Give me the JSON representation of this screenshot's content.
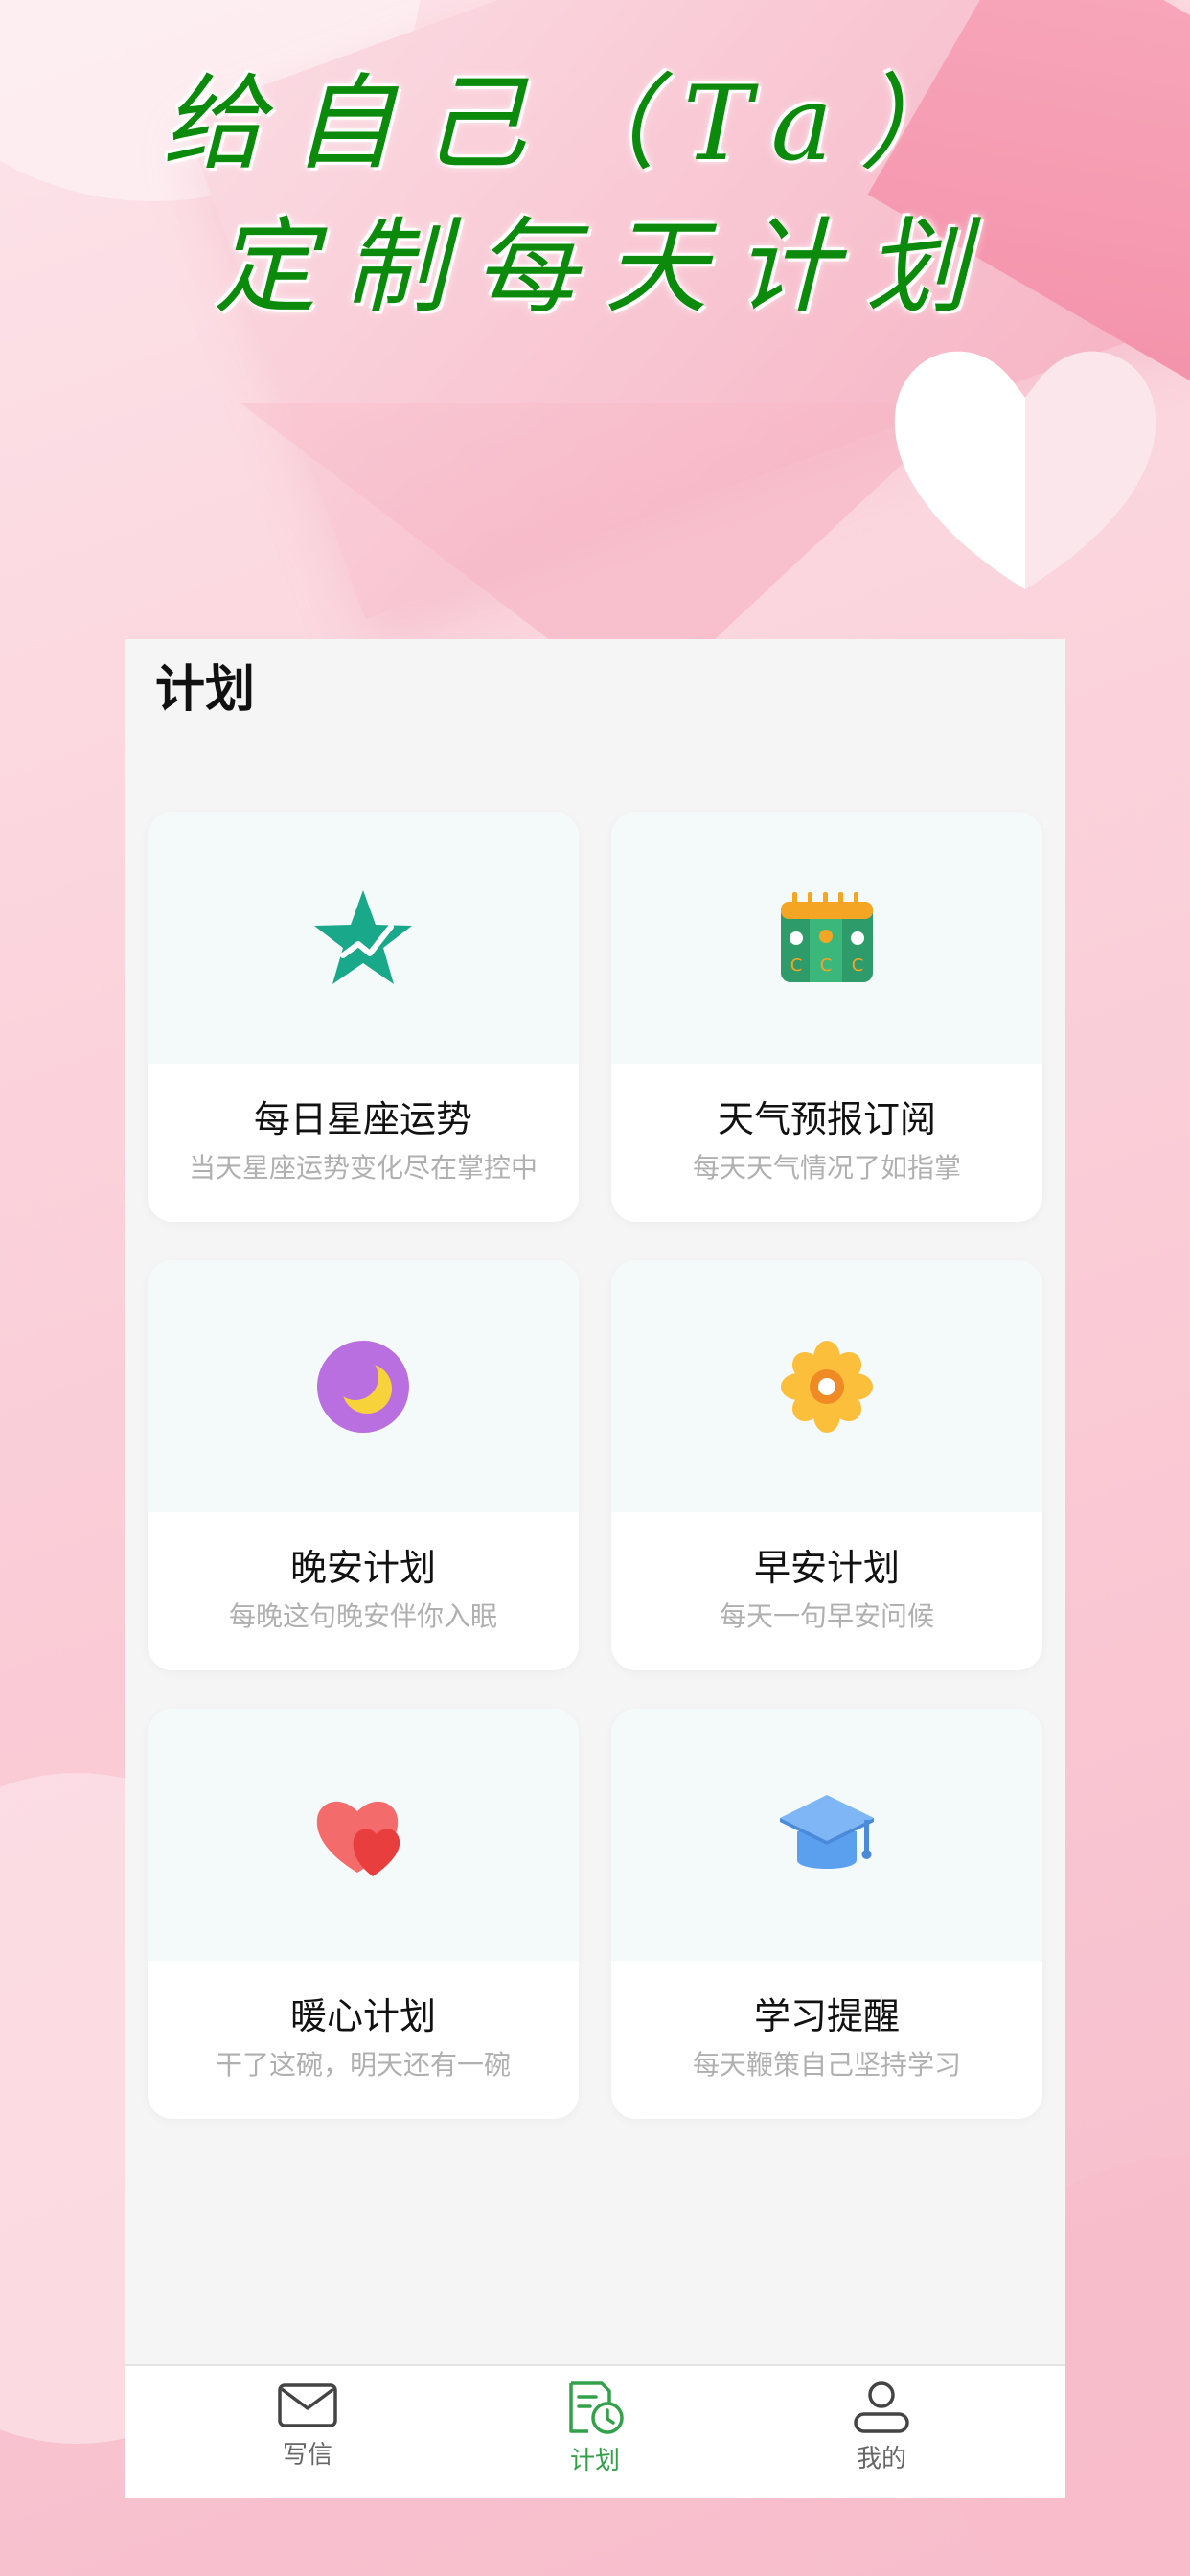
{
  "headline": {
    "line1": "给自己（Ta）",
    "line2": "定制每天计划"
  },
  "page": {
    "title": "计划"
  },
  "cards": [
    {
      "title": "每日星座运势",
      "subtitle": "当天星座运势变化尽在掌控中",
      "icon": "star-chart-icon"
    },
    {
      "title": "天气预报订阅",
      "subtitle": "每天天气情况了如指掌",
      "icon": "weather-calendar-icon"
    },
    {
      "title": "晚安计划",
      "subtitle": "每晚这句晚安伴你入眠",
      "icon": "moon-icon"
    },
    {
      "title": "早安计划",
      "subtitle": "每天一句早安问候",
      "icon": "sun-flower-icon"
    },
    {
      "title": "暖心计划",
      "subtitle": "干了这碗，明天还有一碗",
      "icon": "heart-icon"
    },
    {
      "title": "学习提醒",
      "subtitle": "每天鞭策自己坚持学习",
      "icon": "graduation-cap-icon"
    }
  ],
  "tabbar": {
    "items": [
      {
        "label": "写信",
        "icon": "mail-icon",
        "active": false
      },
      {
        "label": "计划",
        "icon": "plan-clock-icon",
        "active": true
      },
      {
        "label": "我的",
        "icon": "user-icon",
        "active": false
      }
    ]
  },
  "colors": {
    "accent_green": "#33a14a",
    "headline_green": "#0b8a0b",
    "background_pink": "#f9c6d2"
  }
}
